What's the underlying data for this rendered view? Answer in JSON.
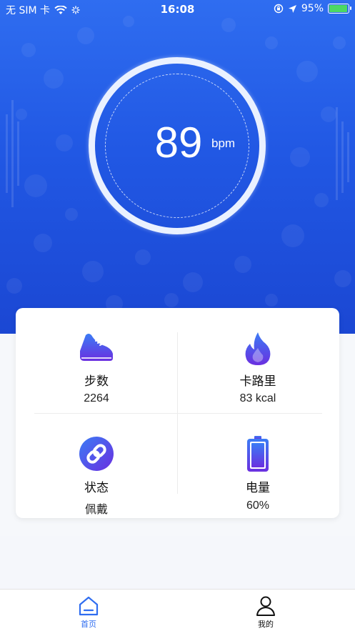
{
  "status_bar": {
    "carrier": "无 SIM 卡",
    "time": "16:08",
    "battery_percent": "95%",
    "battery_level": 0.95,
    "icons": [
      "wifi-icon",
      "loading-icon",
      "orientation-lock-icon",
      "location-icon",
      "battery-icon"
    ]
  },
  "heart_rate": {
    "value": "89",
    "unit": "bpm"
  },
  "stats": {
    "steps": {
      "label": "步数",
      "value": "2264",
      "icon": "shoe-icon"
    },
    "calories": {
      "label": "卡路里",
      "value": "83 kcal",
      "icon": "flame-icon"
    },
    "status": {
      "label": "状态",
      "value": "佩戴",
      "icon": "link-icon"
    },
    "battery": {
      "label": "电量",
      "value": "60%",
      "icon": "battery-level-icon"
    }
  },
  "tabs": [
    {
      "label": "首页",
      "icon": "home-icon",
      "active": true
    },
    {
      "label": "我的",
      "icon": "user-icon",
      "active": false
    }
  ],
  "colors": {
    "accent": "#2f6df0",
    "header_dark": "#1b47d3",
    "icon_gradient_start": "#3b7cf5",
    "icon_gradient_end": "#6a2fe0",
    "battery_green": "#4cd964"
  }
}
